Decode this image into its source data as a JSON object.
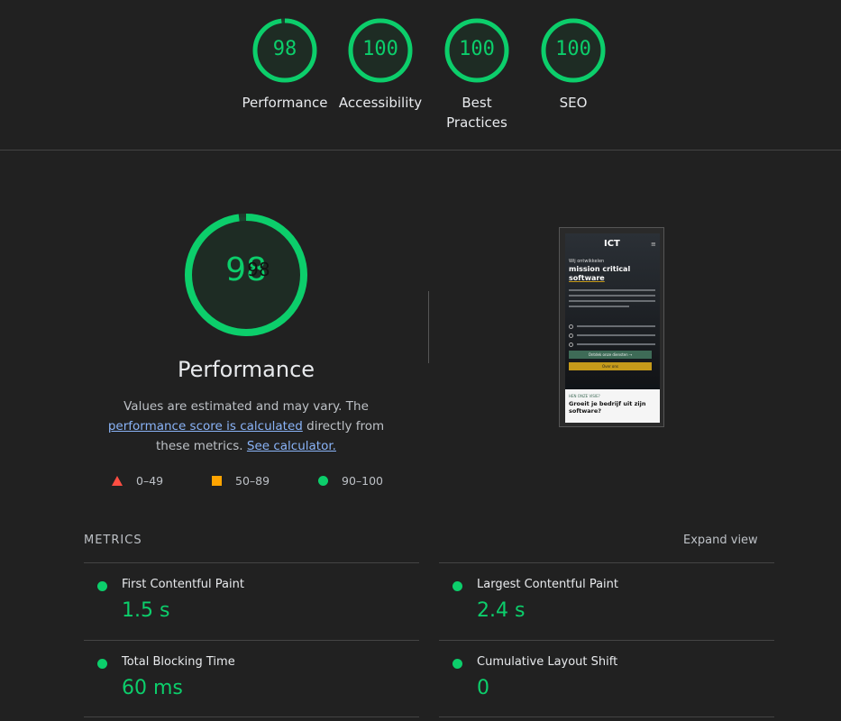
{
  "colors": {
    "pass": "#0cce6b",
    "average": "#ffa400",
    "fail": "#ff4e42",
    "link": "#8ab4f8"
  },
  "categories": [
    {
      "score": "98",
      "score_value": 98,
      "label": "Performance"
    },
    {
      "score": "100",
      "score_value": 100,
      "label": "Accessibility"
    },
    {
      "score": "100",
      "score_value": 100,
      "label": "Best Practices"
    },
    {
      "score": "100",
      "score_value": 100,
      "label": "SEO"
    }
  ],
  "performance": {
    "score": "98",
    "score_value": 98,
    "overlay_score": "98",
    "title": "Performance",
    "desc_prefix": "Values are estimated and may vary. The ",
    "link1": "performance score is calculated",
    "desc_mid": " directly from these metrics. ",
    "link2": "See calculator."
  },
  "legend": [
    {
      "range": "0–49",
      "shape": "triangle-icon"
    },
    {
      "range": "50–89",
      "shape": "square-icon"
    },
    {
      "range": "90–100",
      "shape": "circle-icon"
    }
  ],
  "screenshot": {
    "logo": "ICT",
    "menu_icon": "≡",
    "hero_small": "Wij ontwikkelen",
    "hero_line1": "mission critical",
    "hero_line2": "software",
    "btn_primary": "Ontdek onze diensten →",
    "btn_secondary": "Over ons",
    "section_eyebrow": "HEN ONZE VISIE?",
    "section_title": "Groeit je bedrijf uit zijn software?"
  },
  "metrics": {
    "header": "METRICS",
    "expand_label": "Expand view",
    "items": [
      {
        "name": "First Contentful Paint",
        "value": "1.5 s"
      },
      {
        "name": "Largest Contentful Paint",
        "value": "2.4 s"
      },
      {
        "name": "Total Blocking Time",
        "value": "60 ms"
      },
      {
        "name": "Cumulative Layout Shift",
        "value": "0"
      }
    ]
  }
}
